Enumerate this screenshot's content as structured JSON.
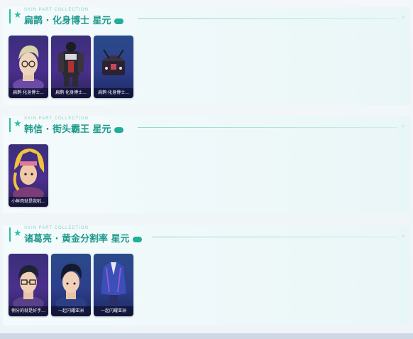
{
  "sections": [
    {
      "subtitle": "SKIN PART COLLECTION",
      "title": "扁鹊 · 化身博士 星元",
      "cards": [
        {
          "label": "扁鹊·化身博士...",
          "icon": "avatar-head-blonde-glasses"
        },
        {
          "label": "扁鹊·化身博士...",
          "icon": "armor-suit-dark"
        },
        {
          "label": "扁鹊·化身博士...",
          "icon": "treasure-chest-dark"
        }
      ]
    },
    {
      "subtitle": "SKIN PART COLLECTION",
      "title": "韩信 · 街头霸王 星元",
      "cards": [
        {
          "label": "小鲜肉就是我啦...",
          "icon": "avatar-head-yellow-crest"
        }
      ]
    },
    {
      "subtitle": "SKIN PART COLLECTION",
      "title": "诸葛亮 · 黄金分割率 星元",
      "cards": [
        {
          "label": "侧分的就是好手...",
          "icon": "avatar-head-glasses"
        },
        {
          "label": "一起闪耀亚洲",
          "icon": "avatar-head-dark-hair"
        },
        {
          "label": "一起闪耀亚洲",
          "icon": "blue-jacket-outfit"
        }
      ]
    }
  ],
  "colors": {
    "accent": "#2dbfa5",
    "title": "#1f9a8c",
    "card_purple": "#4b2f8e",
    "card_blue": "#2d3f8c"
  }
}
